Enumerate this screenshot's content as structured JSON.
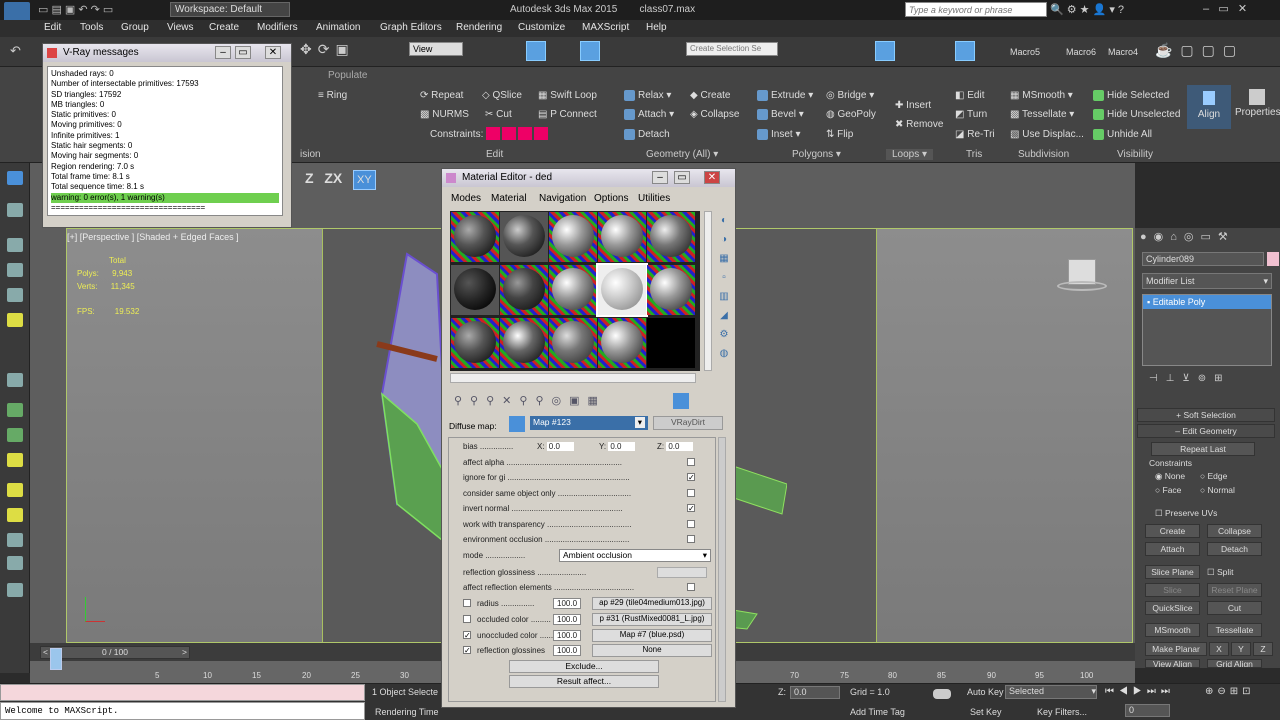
{
  "title": {
    "workspace": "Workspace: Default",
    "app_title": "Autodesk 3ds Max 2015",
    "filename": "class07.max",
    "search_placeholder": "Type a keyword or phrase"
  },
  "menu": [
    "Edit",
    "Tools",
    "Group",
    "Views",
    "Create",
    "Modifiers",
    "Animation",
    "Graph Editors",
    "Rendering",
    "Customize",
    "MAXScript",
    "Help"
  ],
  "toolbar": {
    "view_dropdown": "View",
    "selection_set": "Create Selection Se",
    "macros": [
      "Macro5",
      "Macro6",
      "Macro4"
    ]
  },
  "ribbon": {
    "populate": "Populate",
    "ring": "Ring",
    "repeat": "Repeat",
    "qslice": "QSlice",
    "swift_loop": "Swift Loop",
    "nurms": "NURMS",
    "cut": "Cut",
    "p_connect": "P Connect",
    "constraints": "Constraints:",
    "relax": "Relax",
    "create": "Create",
    "attach": "Attach",
    "collapse": "Collapse",
    "detach": "Detach",
    "extrude": "Extrude",
    "bridge": "Bridge",
    "bevel": "Bevel",
    "geopoly": "GeoPoly",
    "inset": "Inset",
    "flip": "Flip",
    "insert": "Insert",
    "remove": "Remove",
    "edit": "Edit",
    "turn": "Turn",
    "re_tri": "Re-Tri",
    "msmooth": "MSmooth",
    "tessellate": "Tessellate",
    "use_displac": "Use Displac...",
    "hide_selected": "Hide Selected",
    "hide_unselected": "Hide Unselected",
    "unhide_all": "Unhide All",
    "align": "Align",
    "properties": "Properties",
    "groups": {
      "ision": "ision",
      "edit": "Edit",
      "geometry": "Geometry (All)",
      "polygons": "Polygons",
      "loops": "Loops",
      "tris": "Tris",
      "subdivision": "Subdivision",
      "visibility": "Visibility"
    },
    "axis": [
      "Z",
      "ZX",
      "XY"
    ]
  },
  "vray": {
    "title": "V-Ray messages",
    "lines": [
      "Unshaded rays: 0",
      "Number of intersectable primitives: 17593",
      "SD triangles: 17592",
      "MB triangles: 0",
      "Static primitives: 0",
      "Moving primitives: 0",
      "Infinite primitives: 1",
      "Static hair segments: 0",
      "Moving hair segments: 0",
      "Region rendering: 7.0 s",
      "Total frame time: 8.1 s",
      "Total sequence time: 8.1 s"
    ],
    "warning": "warning: 0 error(s), 1 warning(s)",
    "dashes": "================================="
  },
  "viewport": {
    "label": "[+] [Perspective ] [Shaded + Edged Faces ]",
    "total": "Total",
    "polys_label": "Polys:",
    "polys": "9,943",
    "verts_label": "Verts:",
    "verts": "11,345",
    "fps_label": "FPS:",
    "fps": "19.532"
  },
  "material_editor": {
    "title": "Material Editor - ded",
    "menu": [
      "Modes",
      "Material",
      "Navigation",
      "Options",
      "Utilities"
    ],
    "diffuse_label": "Diffuse map:",
    "map_name": "Map #123",
    "map_type": "VRayDirt",
    "bias_label": "bias",
    "bias_x": "0.0",
    "bias_y": "0.0",
    "bias_z": "0.0",
    "params": [
      {
        "label": "affect alpha",
        "checked": false
      },
      {
        "label": "ignore for gi",
        "checked": true
      },
      {
        "label": "consider same object only",
        "checked": false
      },
      {
        "label": "invert normal",
        "checked": true
      },
      {
        "label": "work with transparency",
        "checked": false
      },
      {
        "label": "environment occlusion",
        "checked": false
      }
    ],
    "mode_label": "mode",
    "mode_value": "Ambient occlusion",
    "refl_gloss": "reflection glossiness",
    "affect_refl": "affect reflection elements",
    "maps": [
      {
        "label": "radius",
        "value": "100.0",
        "map": "ap #29 (tile04medium013.jpg)",
        "checked": false
      },
      {
        "label": "occluded color",
        "value": "100.0",
        "map": "p #31 (RustMixed0081_L.jpg)",
        "checked": false
      },
      {
        "label": "unoccluded color",
        "value": "100.0",
        "map": "Map #7 (blue.psd)",
        "checked": true
      },
      {
        "label": "reflection glossines",
        "value": "100.0",
        "map": "None",
        "checked": true
      }
    ],
    "exclude": "Exclude...",
    "result_affect": "Result affect..."
  },
  "command_panel": {
    "object_name": "Cylinder089",
    "modifier_list": "Modifier List",
    "stack_item": "Editable Poly",
    "soft_selection": "Soft Selection",
    "edit_geometry": "Edit Geometry",
    "repeat_last": "Repeat Last",
    "constraints": "Constraints",
    "c_none": "None",
    "c_edge": "Edge",
    "c_face": "Face",
    "c_normal": "Normal",
    "preserve_uvs": "Preserve UVs",
    "create": "Create",
    "collapse": "Collapse",
    "attach": "Attach",
    "detach": "Detach",
    "slice_plane": "Slice Plane",
    "split": "Split",
    "slice": "Slice",
    "reset_plane": "Reset Plane",
    "quickslice": "QuickSlice",
    "cut": "Cut",
    "msmooth": "MSmooth",
    "tessellate": "Tessellate",
    "make_planar": "Make Planar",
    "x": "X",
    "y": "Y",
    "z": "Z",
    "view_align": "View Align",
    "grid_align": "Grid Align"
  },
  "timeline": {
    "frame": "0 / 100",
    "ticks": [
      "5",
      "10",
      "15",
      "20",
      "25",
      "30",
      "70",
      "75",
      "80",
      "85",
      "90",
      "95",
      "100"
    ]
  },
  "status": {
    "maxscript": "Welcome to MAXScript.",
    "selected_count": "1 Object Selecte",
    "rendering_time": "Rendering Time",
    "z_label": "Z:",
    "z_value": "0.0",
    "grid": "Grid = 1.0",
    "add_time_tag": "Add Time Tag",
    "auto_key": "Auto Key",
    "selected": "Selected",
    "set_key": "Set Key",
    "key_filters": "Key Filters...",
    "frame_value": "0"
  },
  "colors": {
    "accent": "#4a90d9",
    "vray_warning": "#6fcf4f",
    "viewport_border": "#b0c86a"
  }
}
